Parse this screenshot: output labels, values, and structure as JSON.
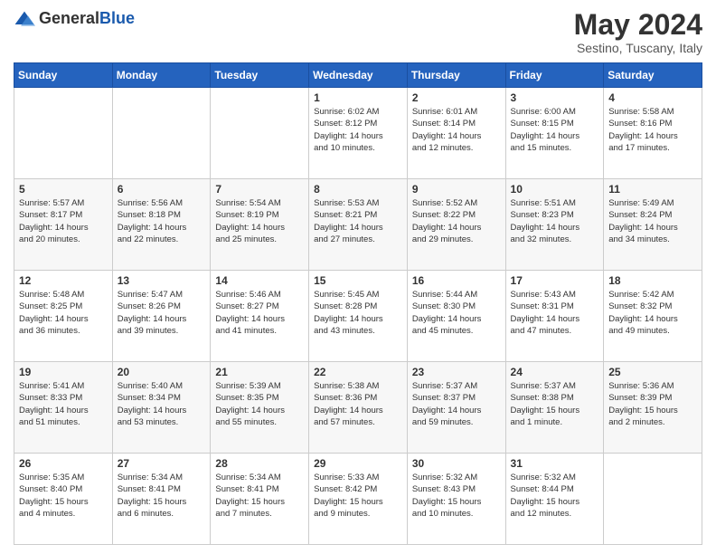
{
  "header": {
    "logo_general": "General",
    "logo_blue": "Blue",
    "month_title": "May 2024",
    "subtitle": "Sestino, Tuscany, Italy"
  },
  "weekdays": [
    "Sunday",
    "Monday",
    "Tuesday",
    "Wednesday",
    "Thursday",
    "Friday",
    "Saturday"
  ],
  "weeks": [
    [
      {
        "day": "",
        "info": ""
      },
      {
        "day": "",
        "info": ""
      },
      {
        "day": "",
        "info": ""
      },
      {
        "day": "1",
        "info": "Sunrise: 6:02 AM\nSunset: 8:12 PM\nDaylight: 14 hours\nand 10 minutes."
      },
      {
        "day": "2",
        "info": "Sunrise: 6:01 AM\nSunset: 8:14 PM\nDaylight: 14 hours\nand 12 minutes."
      },
      {
        "day": "3",
        "info": "Sunrise: 6:00 AM\nSunset: 8:15 PM\nDaylight: 14 hours\nand 15 minutes."
      },
      {
        "day": "4",
        "info": "Sunrise: 5:58 AM\nSunset: 8:16 PM\nDaylight: 14 hours\nand 17 minutes."
      }
    ],
    [
      {
        "day": "5",
        "info": "Sunrise: 5:57 AM\nSunset: 8:17 PM\nDaylight: 14 hours\nand 20 minutes."
      },
      {
        "day": "6",
        "info": "Sunrise: 5:56 AM\nSunset: 8:18 PM\nDaylight: 14 hours\nand 22 minutes."
      },
      {
        "day": "7",
        "info": "Sunrise: 5:54 AM\nSunset: 8:19 PM\nDaylight: 14 hours\nand 25 minutes."
      },
      {
        "day": "8",
        "info": "Sunrise: 5:53 AM\nSunset: 8:21 PM\nDaylight: 14 hours\nand 27 minutes."
      },
      {
        "day": "9",
        "info": "Sunrise: 5:52 AM\nSunset: 8:22 PM\nDaylight: 14 hours\nand 29 minutes."
      },
      {
        "day": "10",
        "info": "Sunrise: 5:51 AM\nSunset: 8:23 PM\nDaylight: 14 hours\nand 32 minutes."
      },
      {
        "day": "11",
        "info": "Sunrise: 5:49 AM\nSunset: 8:24 PM\nDaylight: 14 hours\nand 34 minutes."
      }
    ],
    [
      {
        "day": "12",
        "info": "Sunrise: 5:48 AM\nSunset: 8:25 PM\nDaylight: 14 hours\nand 36 minutes."
      },
      {
        "day": "13",
        "info": "Sunrise: 5:47 AM\nSunset: 8:26 PM\nDaylight: 14 hours\nand 39 minutes."
      },
      {
        "day": "14",
        "info": "Sunrise: 5:46 AM\nSunset: 8:27 PM\nDaylight: 14 hours\nand 41 minutes."
      },
      {
        "day": "15",
        "info": "Sunrise: 5:45 AM\nSunset: 8:28 PM\nDaylight: 14 hours\nand 43 minutes."
      },
      {
        "day": "16",
        "info": "Sunrise: 5:44 AM\nSunset: 8:30 PM\nDaylight: 14 hours\nand 45 minutes."
      },
      {
        "day": "17",
        "info": "Sunrise: 5:43 AM\nSunset: 8:31 PM\nDaylight: 14 hours\nand 47 minutes."
      },
      {
        "day": "18",
        "info": "Sunrise: 5:42 AM\nSunset: 8:32 PM\nDaylight: 14 hours\nand 49 minutes."
      }
    ],
    [
      {
        "day": "19",
        "info": "Sunrise: 5:41 AM\nSunset: 8:33 PM\nDaylight: 14 hours\nand 51 minutes."
      },
      {
        "day": "20",
        "info": "Sunrise: 5:40 AM\nSunset: 8:34 PM\nDaylight: 14 hours\nand 53 minutes."
      },
      {
        "day": "21",
        "info": "Sunrise: 5:39 AM\nSunset: 8:35 PM\nDaylight: 14 hours\nand 55 minutes."
      },
      {
        "day": "22",
        "info": "Sunrise: 5:38 AM\nSunset: 8:36 PM\nDaylight: 14 hours\nand 57 minutes."
      },
      {
        "day": "23",
        "info": "Sunrise: 5:37 AM\nSunset: 8:37 PM\nDaylight: 14 hours\nand 59 minutes."
      },
      {
        "day": "24",
        "info": "Sunrise: 5:37 AM\nSunset: 8:38 PM\nDaylight: 15 hours\nand 1 minute."
      },
      {
        "day": "25",
        "info": "Sunrise: 5:36 AM\nSunset: 8:39 PM\nDaylight: 15 hours\nand 2 minutes."
      }
    ],
    [
      {
        "day": "26",
        "info": "Sunrise: 5:35 AM\nSunset: 8:40 PM\nDaylight: 15 hours\nand 4 minutes."
      },
      {
        "day": "27",
        "info": "Sunrise: 5:34 AM\nSunset: 8:41 PM\nDaylight: 15 hours\nand 6 minutes."
      },
      {
        "day": "28",
        "info": "Sunrise: 5:34 AM\nSunset: 8:41 PM\nDaylight: 15 hours\nand 7 minutes."
      },
      {
        "day": "29",
        "info": "Sunrise: 5:33 AM\nSunset: 8:42 PM\nDaylight: 15 hours\nand 9 minutes."
      },
      {
        "day": "30",
        "info": "Sunrise: 5:32 AM\nSunset: 8:43 PM\nDaylight: 15 hours\nand 10 minutes."
      },
      {
        "day": "31",
        "info": "Sunrise: 5:32 AM\nSunset: 8:44 PM\nDaylight: 15 hours\nand 12 minutes."
      },
      {
        "day": "",
        "info": ""
      }
    ]
  ]
}
